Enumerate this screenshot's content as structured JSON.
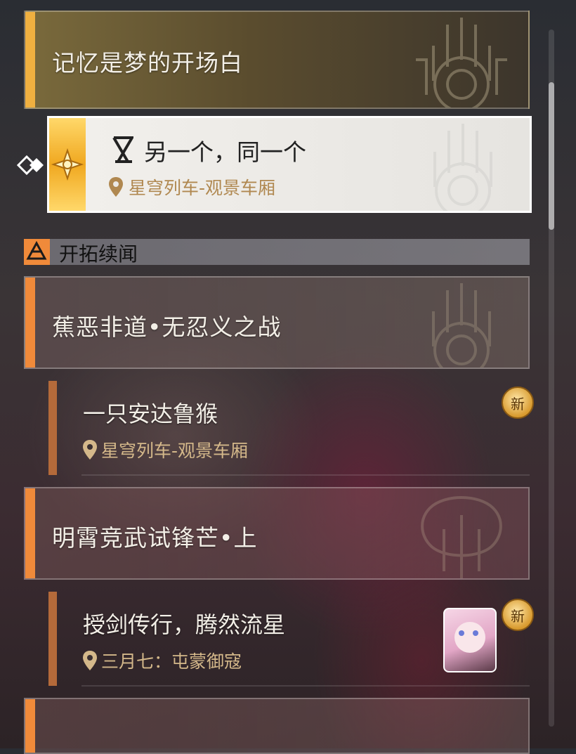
{
  "quests": {
    "memory": {
      "title": "记忆是梦的开场白"
    },
    "another": {
      "title": "另一个，同一个",
      "location": "星穹列车-观景车厢"
    },
    "section_label": "开拓续闻",
    "banana": {
      "title": "蕉恶非道•无忍义之战"
    },
    "monkey": {
      "title": "一只安达鲁猴",
      "location": "星穹列车-观景车厢",
      "badge": "新"
    },
    "xiaoyu": {
      "title": "明霄竞武试锋芒•上"
    },
    "sword": {
      "title": "授剑传行，腾然流星",
      "location": "三月七：屯蒙御寇",
      "badge": "新"
    },
    "partial": {
      "title": ""
    }
  },
  "colors": {
    "accent_gold": "#f0b040",
    "accent_orange": "#f08a3a",
    "location_text": "#d4b88a"
  },
  "icons": [
    "hourglass-icon",
    "location-pin-icon",
    "tracking-arrow-icon",
    "star-badge-icon",
    "trailblaze-icon",
    "quest-emblem-icon",
    "character-avatar-icon"
  ]
}
